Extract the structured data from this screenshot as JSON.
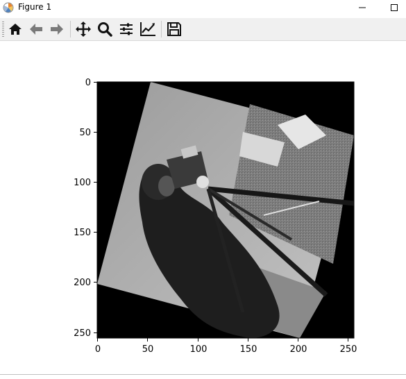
{
  "window": {
    "title": "Figure 1",
    "minimize_glyph": "—",
    "maximize_glyph": "☐"
  },
  "toolbar": {
    "buttons": [
      {
        "icon": "home-icon",
        "tooltip": "Reset original view"
      },
      {
        "icon": "back-arrow-icon",
        "tooltip": "Back to previous view"
      },
      {
        "icon": "forward-arrow-icon",
        "tooltip": "Forward to next view"
      },
      {
        "icon": "pan-icon",
        "tooltip": "Pan axes"
      },
      {
        "icon": "zoom-icon",
        "tooltip": "Zoom to rectangle"
      },
      {
        "icon": "subplots-icon",
        "tooltip": "Configure subplots"
      },
      {
        "icon": "edit-axis-icon",
        "tooltip": "Edit axis, curve and image parameters"
      },
      {
        "icon": "save-icon",
        "tooltip": "Save the figure"
      }
    ]
  },
  "chart_data": {
    "type": "image",
    "colormap": "gray",
    "x_ticks": [
      "0",
      "50",
      "100",
      "150",
      "200",
      "250"
    ],
    "y_ticks": [
      "0",
      "50",
      "100",
      "150",
      "200",
      "250"
    ],
    "xlim": [
      0,
      256
    ],
    "ylim": [
      256,
      0
    ],
    "rotation_degrees": 30
  }
}
